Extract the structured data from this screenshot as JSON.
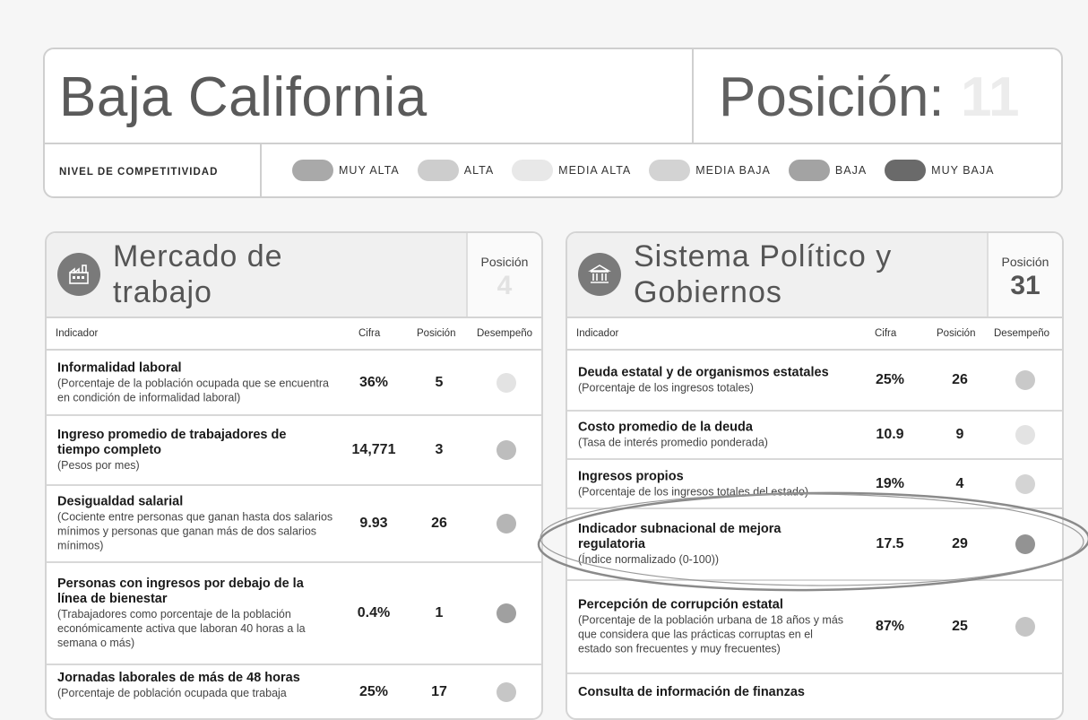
{
  "header": {
    "state": "Baja California",
    "position_label": "Posición:",
    "position_value": "11"
  },
  "legend": {
    "title": "NIVEL DE COMPETITIVIDAD",
    "items": [
      {
        "label": "MUY ALTA",
        "color": "#a9a9a9"
      },
      {
        "label": "ALTA",
        "color": "#cdcdcd"
      },
      {
        "label": "MEDIA ALTA",
        "color": "#e8e8e8"
      },
      {
        "label": "MEDIA BAJA",
        "color": "#d3d3d3"
      },
      {
        "label": "BAJA",
        "color": "#a3a3a3"
      },
      {
        "label": "MUY BAJA",
        "color": "#6a6a6a"
      }
    ]
  },
  "left_panel": {
    "title_line1": "Mercado de",
    "title_line2": "trabajo",
    "position_label": "Posición",
    "position_value": "4",
    "columns": {
      "indicator": "Indicador",
      "cifra": "Cifra",
      "posicion": "Posición",
      "desempeno": "Desempeño"
    },
    "rows": [
      {
        "name": "Informalidad laboral",
        "desc": "(Porcentaje de la población ocupada que se encuentra en condición de informalidad laboral)",
        "cifra": "36%",
        "pos": "5",
        "color": "#e3e3e3"
      },
      {
        "name": "Ingreso promedio de trabajadores de tiempo completo",
        "desc": "(Pesos por mes)",
        "cifra": "14,771",
        "pos": "3",
        "color": "#bdbdbd"
      },
      {
        "name": "Desigualdad salarial",
        "desc": "(Cociente entre personas que ganan hasta dos salarios mínimos y personas que ganan más de dos salarios mínimos)",
        "cifra": "9.93",
        "pos": "26",
        "color": "#b5b5b5"
      },
      {
        "name": "Personas con ingresos por debajo de la línea de bienestar",
        "desc": "(Trabajadores como porcentaje de la población económicamente activa que laboran 40 horas a la semana o más)",
        "cifra": "0.4%",
        "pos": "1",
        "color": "#a0a0a0"
      },
      {
        "name": "Jornadas laborales de más de 48 horas",
        "desc": "(Porcentaje de población ocupada que trabaja",
        "cifra": "25%",
        "pos": "17",
        "color": "#c6c6c6"
      }
    ]
  },
  "right_panel": {
    "title_line1": "Sistema Político y",
    "title_line2": "Gobiernos",
    "position_label": "Posición",
    "position_value": "31",
    "columns": {
      "indicator": "Indicador",
      "cifra": "Cifra",
      "posicion": "Posición",
      "desempeno": "Desempeño"
    },
    "rows": [
      {
        "name": "Deuda estatal y de organismos estatales",
        "desc": "(Porcentaje de los ingresos totales)",
        "cifra": "25%",
        "pos": "26",
        "color": "#c9c9c9"
      },
      {
        "name": "Costo promedio de la deuda",
        "desc": "(Tasa de interés promedio ponderada)",
        "cifra": "10.9",
        "pos": "9",
        "color": "#e3e3e3"
      },
      {
        "name": "Ingresos propios",
        "desc": "(Porcentaje de los ingresos totales del estado)",
        "cifra": "19%",
        "pos": "4",
        "color": "#d4d4d4"
      },
      {
        "name": "Indicador subnacional de mejora regulatoria",
        "desc": "(Índice normalizado (0-100))",
        "cifra": "17.5",
        "pos": "29",
        "color": "#939393"
      },
      {
        "name": "Percepción de corrupción estatal",
        "desc": "(Porcentaje de la población urbana de 18 años y más que considera que las prácticas corruptas en el estado son frecuentes y muy frecuentes)",
        "cifra": "87%",
        "pos": "25",
        "color": "#c5c5c5"
      },
      {
        "name": "Consulta de información de finanzas",
        "desc": "",
        "cifra": "",
        "pos": "",
        "color": ""
      }
    ]
  }
}
